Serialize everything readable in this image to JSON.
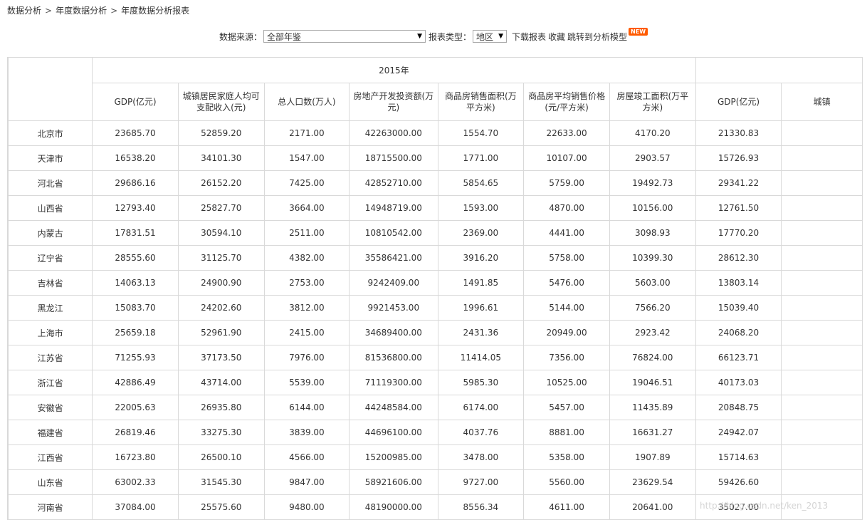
{
  "breadcrumb": {
    "items": [
      "数据分析",
      "年度数据分析",
      "年度数据分析报表"
    ],
    "separator": ">"
  },
  "toolbar": {
    "source_label": "数据来源：",
    "source_value": "全部年鉴",
    "type_label": "报表类型：",
    "type_value": "地区",
    "download_label": "下载报表",
    "favorite_label": "收藏",
    "jump_label": "跳转到分析模型",
    "new_badge": "NEW"
  },
  "table": {
    "year": "2015年",
    "columns": [
      "GDP(亿元)",
      "城镇居民家庭人均可支配收入(元)",
      "总人口数(万人)",
      "房地产开发投资额(万元)",
      "商品房销售面积(万平方米)",
      "商品房平均销售价格(元/平方米)",
      "房屋竣工面积(万平方米)",
      "GDP(亿元)",
      "城镇"
    ],
    "rows": [
      {
        "region": "北京市",
        "cells": [
          "23685.70",
          "52859.20",
          "2171.00",
          "42263000.00",
          "1554.70",
          "22633.00",
          "4170.20",
          "21330.83",
          ""
        ]
      },
      {
        "region": "天津市",
        "cells": [
          "16538.20",
          "34101.30",
          "1547.00",
          "18715500.00",
          "1771.00",
          "10107.00",
          "2903.57",
          "15726.93",
          ""
        ]
      },
      {
        "region": "河北省",
        "cells": [
          "29686.16",
          "26152.20",
          "7425.00",
          "42852710.00",
          "5854.65",
          "5759.00",
          "19492.73",
          "29341.22",
          ""
        ]
      },
      {
        "region": "山西省",
        "cells": [
          "12793.40",
          "25827.70",
          "3664.00",
          "14948719.00",
          "1593.00",
          "4870.00",
          "10156.00",
          "12761.50",
          ""
        ]
      },
      {
        "region": "内蒙古",
        "cells": [
          "17831.51",
          "30594.10",
          "2511.00",
          "10810542.00",
          "2369.00",
          "4441.00",
          "3098.93",
          "17770.20",
          ""
        ]
      },
      {
        "region": "辽宁省",
        "cells": [
          "28555.60",
          "31125.70",
          "4382.00",
          "35586421.00",
          "3916.20",
          "5758.00",
          "10399.30",
          "28612.30",
          ""
        ]
      },
      {
        "region": "吉林省",
        "cells": [
          "14063.13",
          "24900.90",
          "2753.00",
          "9242409.00",
          "1491.85",
          "5476.00",
          "5603.00",
          "13803.14",
          ""
        ]
      },
      {
        "region": "黑龙江",
        "cells": [
          "15083.70",
          "24202.60",
          "3812.00",
          "9921453.00",
          "1996.61",
          "5144.00",
          "7566.20",
          "15039.40",
          ""
        ]
      },
      {
        "region": "上海市",
        "cells": [
          "25659.18",
          "52961.90",
          "2415.00",
          "34689400.00",
          "2431.36",
          "20949.00",
          "2923.42",
          "24068.20",
          ""
        ]
      },
      {
        "region": "江苏省",
        "cells": [
          "71255.93",
          "37173.50",
          "7976.00",
          "81536800.00",
          "11414.05",
          "7356.00",
          "76824.00",
          "66123.71",
          ""
        ]
      },
      {
        "region": "浙江省",
        "cells": [
          "42886.49",
          "43714.00",
          "5539.00",
          "71119300.00",
          "5985.30",
          "10525.00",
          "19046.51",
          "40173.03",
          ""
        ]
      },
      {
        "region": "安徽省",
        "cells": [
          "22005.63",
          "26935.80",
          "6144.00",
          "44248584.00",
          "6174.00",
          "5457.00",
          "11435.89",
          "20848.75",
          ""
        ]
      },
      {
        "region": "福建省",
        "cells": [
          "26819.46",
          "33275.30",
          "3839.00",
          "44696100.00",
          "4037.76",
          "8881.00",
          "16631.27",
          "24942.07",
          ""
        ]
      },
      {
        "region": "江西省",
        "cells": [
          "16723.80",
          "26500.10",
          "4566.00",
          "15200985.00",
          "3478.00",
          "5358.00",
          "1907.89",
          "15714.63",
          ""
        ]
      },
      {
        "region": "山东省",
        "cells": [
          "63002.33",
          "31545.30",
          "9847.00",
          "58921606.00",
          "9727.00",
          "5560.00",
          "23629.54",
          "59426.60",
          ""
        ]
      },
      {
        "region": "河南省",
        "cells": [
          "37084.00",
          "25575.60",
          "9480.00",
          "48190000.00",
          "8556.34",
          "4611.00",
          "20641.00",
          "35027.00",
          ""
        ]
      }
    ]
  },
  "watermark": "http://blog.csdn.net/ken_2013"
}
